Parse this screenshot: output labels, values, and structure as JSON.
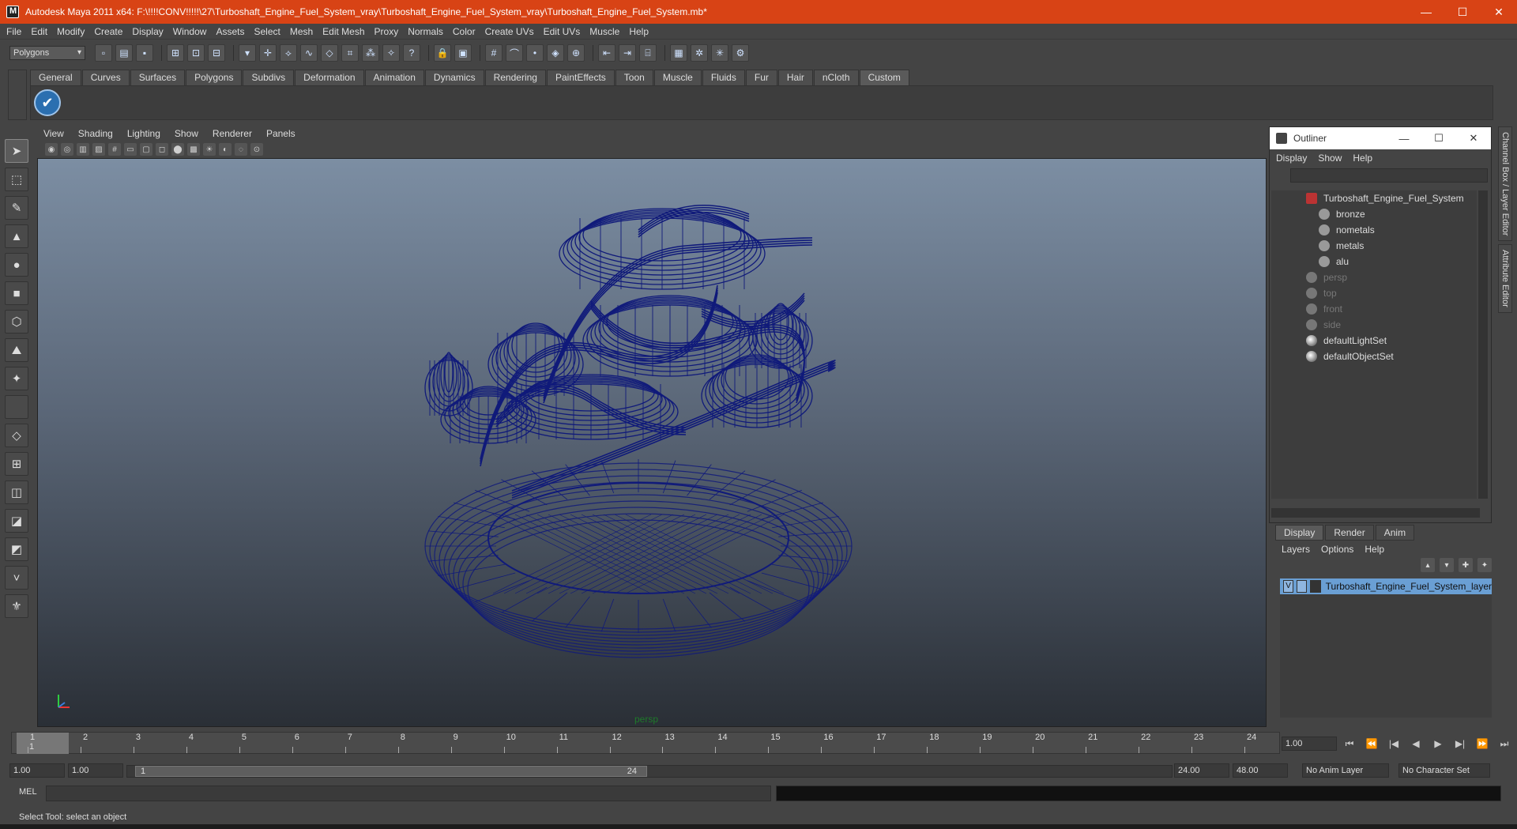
{
  "window": {
    "title": "Autodesk Maya 2011 x64: F:\\!!!!CONV!!!!!\\27\\Turboshaft_Engine_Fuel_System_vray\\Turboshaft_Engine_Fuel_System_vray\\Turboshaft_Engine_Fuel_System.mb*",
    "minimize": "—",
    "maximize": "☐",
    "close": "✕"
  },
  "menubar": [
    "File",
    "Edit",
    "Modify",
    "Create",
    "Display",
    "Window",
    "Assets",
    "Select",
    "Mesh",
    "Edit Mesh",
    "Proxy",
    "Normals",
    "Color",
    "Create UVs",
    "Edit UVs",
    "Muscle",
    "Help"
  ],
  "statusline": {
    "mode": "Polygons"
  },
  "shelf": {
    "tabs": [
      "General",
      "Curves",
      "Surfaces",
      "Polygons",
      "Subdivs",
      "Deformation",
      "Animation",
      "Dynamics",
      "Rendering",
      "PaintEffects",
      "Toon",
      "Muscle",
      "Fluids",
      "Fur",
      "Hair",
      "nCloth",
      "Custom"
    ],
    "active_tab": "Custom",
    "button_glyph": "✔"
  },
  "viewport": {
    "menu": [
      "View",
      "Shading",
      "Lighting",
      "Show",
      "Renderer",
      "Panels"
    ],
    "camera_label": "persp",
    "wire_color": "#101a7a"
  },
  "outliner": {
    "title": "Outliner",
    "menu": [
      "Display",
      "Show",
      "Help"
    ],
    "items": [
      {
        "label": "Turboshaft_Engine_Fuel_System",
        "type": "group",
        "dim": false
      },
      {
        "label": "bronze",
        "type": "mesh",
        "dim": false
      },
      {
        "label": "nometals",
        "type": "mesh",
        "dim": false
      },
      {
        "label": "metals",
        "type": "mesh",
        "dim": false
      },
      {
        "label": "alu",
        "type": "mesh",
        "dim": false
      },
      {
        "label": "persp",
        "type": "camera",
        "dim": true
      },
      {
        "label": "top",
        "type": "camera",
        "dim": true
      },
      {
        "label": "front",
        "type": "camera",
        "dim": true
      },
      {
        "label": "side",
        "type": "camera",
        "dim": true
      },
      {
        "label": "defaultLightSet",
        "type": "set",
        "dim": false
      },
      {
        "label": "defaultObjectSet",
        "type": "set",
        "dim": false
      }
    ]
  },
  "layer_editor": {
    "tabs": [
      "Display",
      "Render",
      "Anim"
    ],
    "active_tab": "Display",
    "menu": [
      "Layers",
      "Options",
      "Help"
    ],
    "layer": {
      "visible": "V",
      "name": "Turboshaft_Engine_Fuel_System_layer"
    }
  },
  "side_tabs": [
    "Channel Box / Layer Editor",
    "Attribute Editor"
  ],
  "timeline": {
    "ticks": [
      1,
      2,
      3,
      4,
      5,
      6,
      7,
      8,
      9,
      10,
      11,
      12,
      13,
      14,
      15,
      16,
      17,
      18,
      19,
      20,
      21,
      22,
      23,
      24
    ],
    "current_frame": "1",
    "current_time": "1.00"
  },
  "playback_controls": [
    "⏮",
    "⏪",
    "|◀",
    "◀",
    "▶",
    "▶|",
    "⏩",
    "⏭"
  ],
  "range": {
    "start": "1.00",
    "playback_start": "1.00",
    "handle_start": "1",
    "handle_end": "24",
    "playback_end": "24.00",
    "end": "48.00",
    "anim_layer": "No Anim Layer",
    "character_set": "No Character Set"
  },
  "command_line": {
    "label": "MEL"
  },
  "help_line": "Select Tool: select an object"
}
